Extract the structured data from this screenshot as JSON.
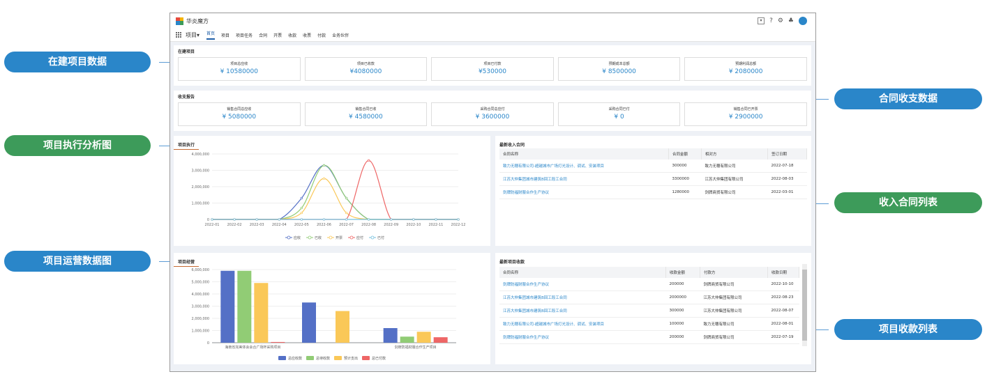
{
  "callouts": {
    "building_data": "在建项目数据",
    "contract_data": "合同收支数据",
    "execution_chart": "项目执行分析图",
    "income_contracts": "收入合同列表",
    "operation_chart": "项目运营数据图",
    "collection_list": "项目收款列表"
  },
  "app": {
    "title": "华炎魔方",
    "app_switch": "项目",
    "chevron": "▾"
  },
  "top_icons": [
    "box-arrow-icon",
    "help-icon",
    "gear-icon",
    "bell-icon",
    "user-avatar-icon"
  ],
  "top_icon_glyphs": {
    "help": "?",
    "gear": "⚙",
    "bell": "♣"
  },
  "nav_tabs": [
    "首页",
    "项目",
    "项目任务",
    "合同",
    "开票",
    "收款",
    "收票",
    "付款",
    "业务伙伴"
  ],
  "building": {
    "title": "在建项目",
    "cards": [
      {
        "label": "项目总应收",
        "value": "¥ 10580000"
      },
      {
        "label": "项目已收款",
        "value": "¥4080000"
      },
      {
        "label": "项目已付款",
        "value": "¥530000"
      },
      {
        "label": "预期成本总额",
        "value": "¥ 8500000"
      },
      {
        "label": "预期利润总额",
        "value": "¥ 2080000"
      }
    ]
  },
  "finance": {
    "title": "收支报告",
    "cards": [
      {
        "label": "销售合同总应收",
        "value": "¥ 5080000"
      },
      {
        "label": "销售合同已收",
        "value": "¥ 4580000"
      },
      {
        "label": "采购合同总应付",
        "value": "¥ 3600000"
      },
      {
        "label": "采购合同已付",
        "value": "¥ 0"
      },
      {
        "label": "销售合同已开票",
        "value": "¥ 2900000"
      }
    ]
  },
  "execution": {
    "title": "项目执行"
  },
  "operation": {
    "title": "项目经营"
  },
  "income_contracts": {
    "title": "最新收入合同",
    "columns": [
      "合同名称",
      "合同金额",
      "相对方",
      "签订日期"
    ],
    "rows": [
      [
        "致力无穗有限公司-超越城市广场灯光设计、调试、安装项目",
        "300000",
        "致力无穗有限公司",
        "2022-07-18"
      ],
      [
        "江苏大仲集团城市建筑B回工段工合同",
        "3300000",
        "江苏大仲集团有限公司",
        "2022-08-03"
      ],
      [
        "剑牌防福财服合作生产协议",
        "1280000",
        "剑牌商贸有限公司",
        "2022-03-01"
      ]
    ]
  },
  "collections": {
    "title": "最新项目收款",
    "columns": [
      "合同名称",
      "收款金额",
      "付款方",
      "收款日期"
    ],
    "rows": [
      [
        "剑牌防福财服合作生产协议",
        "200000",
        "剑牌商贸有限公司",
        "2022-10-10"
      ],
      [
        "江苏大仲集团城市建筑B回工段工合同",
        "2000000",
        "江苏大仲集团有限公司",
        "2022-08-23"
      ],
      [
        "江苏大仲集团城市建筑B回工段工合同",
        "300000",
        "江苏大仲集团有限公司",
        "2022-08-07"
      ],
      [
        "致力无穗有限公司-超越城市广场灯光设计、调试、安装项目",
        "100000",
        "致力无穗有限公司",
        "2022-08-01"
      ],
      [
        "剑牌防福财服合作生产协议",
        "200000",
        "剑牌商贸有限公司",
        "2022-07-19"
      ]
    ]
  },
  "chart_data": [
    {
      "type": "line",
      "x": [
        "2022-01",
        "2022-02",
        "2022-03",
        "2022-04",
        "2022-05",
        "2022-06",
        "2022-07",
        "2022-08",
        "2022-09",
        "2022-10",
        "2022-11",
        "2022-12"
      ],
      "ylim": [
        0,
        4000000
      ],
      "yticks": [
        "0",
        "1,000,000",
        "2,000,000",
        "3,000,000",
        "4,000,000"
      ],
      "series": [
        {
          "name": "应收",
          "color": "#5470c6",
          "values": [
            0,
            0,
            0,
            0,
            1300000,
            3300000,
            1300000,
            0,
            0,
            0,
            0,
            0
          ]
        },
        {
          "name": "已收",
          "color": "#91cc75",
          "values": [
            0,
            0,
            0,
            0,
            700000,
            3300000,
            1300000,
            0,
            0,
            0,
            0,
            0
          ]
        },
        {
          "name": "开票",
          "color": "#fac858",
          "values": [
            0,
            0,
            0,
            0,
            400000,
            2500000,
            400000,
            0,
            0,
            0,
            0,
            0
          ]
        },
        {
          "name": "应付",
          "color": "#ee6666",
          "values": [
            0,
            0,
            0,
            0,
            0,
            0,
            0,
            3600000,
            0,
            0,
            0,
            0
          ]
        },
        {
          "name": "已付",
          "color": "#73c0de",
          "values": [
            0,
            0,
            0,
            0,
            0,
            0,
            0,
            0,
            0,
            0,
            0,
            0
          ]
        }
      ],
      "grid": true,
      "legend": "bottom"
    },
    {
      "type": "bar",
      "categories": [
        "海南省完美体会会合广场杯采购项目",
        "",
        "剑牌防福财服合作生产项目"
      ],
      "ylim": [
        0,
        6000000
      ],
      "yticks": [
        "0",
        "1,000,000",
        "2,000,000",
        "3,000,000",
        "4,000,000",
        "5,000,000",
        "6,000,000"
      ],
      "series": [
        {
          "name": "总应收款",
          "color": "#5470c6",
          "values": [
            5900000,
            3300000,
            1200000
          ]
        },
        {
          "name": "总待收款",
          "color": "#91cc75",
          "values": [
            5900000,
            0,
            500000
          ]
        },
        {
          "name": "预计支出",
          "color": "#fac858",
          "values": [
            4900000,
            2600000,
            900000
          ]
        },
        {
          "name": "总已付款",
          "color": "#ee6666",
          "values": [
            60000,
            0,
            450000
          ]
        }
      ],
      "grid": true,
      "legend": "bottom"
    }
  ]
}
